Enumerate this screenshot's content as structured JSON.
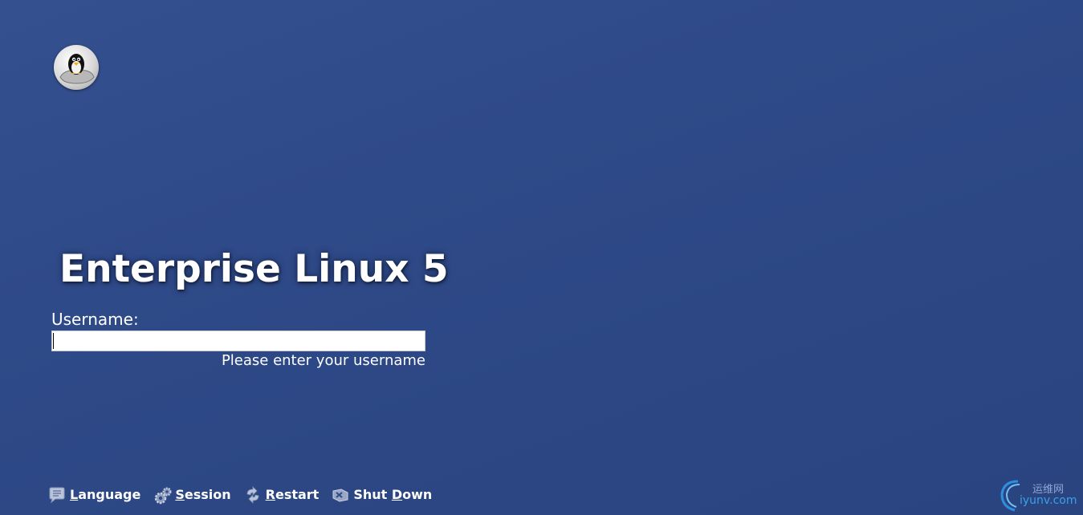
{
  "header": {
    "logo_icon": "tux-penguin-logo-icon"
  },
  "login": {
    "title": "Enterprise Linux 5",
    "username_label": "Username:",
    "username_value": "",
    "hint": "Please enter your username"
  },
  "bottom_bar": {
    "items": [
      {
        "icon": "speech-bubble-icon",
        "access_key": "L",
        "rest": "anguage"
      },
      {
        "icon": "gears-icon",
        "access_key": "S",
        "rest": "ession"
      },
      {
        "icon": "restart-arrows-icon",
        "access_key": "R",
        "rest": "estart"
      },
      {
        "icon": "shutdown-icon",
        "pre": "Shut ",
        "access_key": "D",
        "rest": "own"
      }
    ]
  },
  "watermark": {
    "top_text": "运维网",
    "bottom_text": "iyunv.com"
  },
  "colors": {
    "background": "#2f4a88",
    "text": "#ffffff",
    "input_bg": "#ffffff"
  }
}
